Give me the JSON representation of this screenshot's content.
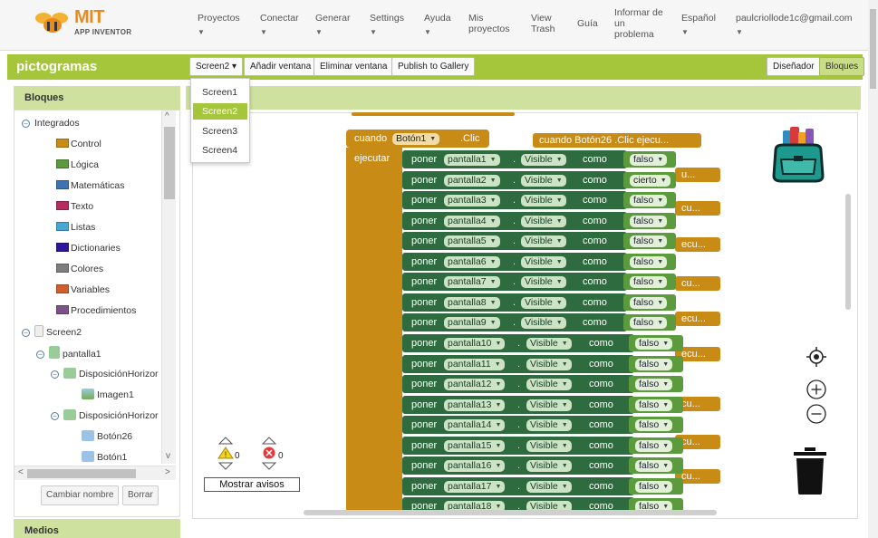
{
  "header": {
    "logo_title": "MIT",
    "logo_sub": "APP INVENTOR",
    "menus": [
      {
        "label": "Proyectos",
        "dropdown": true
      },
      {
        "label": "Conectar",
        "dropdown": true
      },
      {
        "label": "Generar",
        "dropdown": true
      },
      {
        "label": "Settings",
        "dropdown": true
      },
      {
        "label": "Ayuda",
        "dropdown": true
      },
      {
        "label": "Mis proyectos",
        "dropdown": false
      },
      {
        "label": "View Trash",
        "dropdown": false
      },
      {
        "label": "Guía",
        "dropdown": false
      },
      {
        "label": "Informar de un problema",
        "dropdown": false
      },
      {
        "label": "Español",
        "dropdown": true
      },
      {
        "label": "paulcriollode1c@gmail.com",
        "dropdown": true
      }
    ]
  },
  "project_bar": {
    "project_name": "pictogramas",
    "screen_select": "Screen2 ▾",
    "add_screen": "Añadir ventana",
    "remove_screen": "Eliminar ventana",
    "publish": "Publish to Gallery",
    "designer": "Diseñador",
    "blocks": "Bloques"
  },
  "screen_dropdown": {
    "options": [
      "Screen1",
      "Screen2",
      "Screen3",
      "Screen4"
    ],
    "selected": "Screen2"
  },
  "left_panel": {
    "title": "Bloques",
    "builtin_label": "Integrados",
    "builtins": [
      {
        "label": "Control",
        "color": "#c88b15"
      },
      {
        "label": "Lógica",
        "color": "#5c9a3e"
      },
      {
        "label": "Matemáticas",
        "color": "#3f71b5"
      },
      {
        "label": "Texto",
        "color": "#b32d5e"
      },
      {
        "label": "Listas",
        "color": "#49a6d4"
      },
      {
        "label": "Dictionaries",
        "color": "#2d1799"
      },
      {
        "label": "Colores",
        "color": "#7d7d7d"
      },
      {
        "label": "Variables",
        "color": "#d05f2d"
      },
      {
        "label": "Procedimientos",
        "color": "#7c5385"
      }
    ],
    "components": [
      "Screen2",
      "pantalla1",
      "DisposiciónHorizor",
      "Imagen1",
      "DisposiciónHorizor",
      "Botón26",
      "Botón1"
    ],
    "rename_button": "Cambiar nombre",
    "delete_button": "Borrar",
    "media_title": "Medios"
  },
  "workspace": {
    "main_event": {
      "when": "cuando",
      "component": "Botón1",
      "event": ".Clic",
      "do": "ejecutar"
    },
    "set_word": "poner",
    "property": "Visible",
    "as_word": "como",
    "rows": [
      {
        "target": "pantalla1",
        "value": "falso"
      },
      {
        "target": "pantalla2",
        "value": "cierto"
      },
      {
        "target": "pantalla3",
        "value": "falso"
      },
      {
        "target": "pantalla4",
        "value": "falso"
      },
      {
        "target": "pantalla5",
        "value": "falso"
      },
      {
        "target": "pantalla6",
        "value": "falso"
      },
      {
        "target": "pantalla7",
        "value": "falso"
      },
      {
        "target": "pantalla8",
        "value": "falso"
      },
      {
        "target": "pantalla9",
        "value": "falso"
      },
      {
        "target": "pantalla10",
        "value": "falso"
      },
      {
        "target": "pantalla11",
        "value": "falso"
      },
      {
        "target": "pantalla12",
        "value": "falso"
      },
      {
        "target": "pantalla13",
        "value": "falso"
      },
      {
        "target": "pantalla14",
        "value": "falso"
      },
      {
        "target": "pantalla15",
        "value": "falso"
      },
      {
        "target": "pantalla16",
        "value": "falso"
      },
      {
        "target": "pantalla17",
        "value": "falso"
      },
      {
        "target": "pantalla18",
        "value": "falso"
      }
    ],
    "collapsed_block": "cuando  Botón26 .Clic ejecu...",
    "peek_labels": [
      "u...",
      "cu...",
      "ecu...",
      "cu...",
      "ecu...",
      "ecu...",
      "cu...",
      "cu...",
      "cu..."
    ],
    "warnings_count": "0",
    "errors_count": "0",
    "show_warnings": "Mostrar avisos"
  },
  "colors": {
    "accent_green": "#a5c63b",
    "control_gold": "#c88b15",
    "component_green": "#2e6b3e",
    "logic_green": "#5c9a3e"
  }
}
